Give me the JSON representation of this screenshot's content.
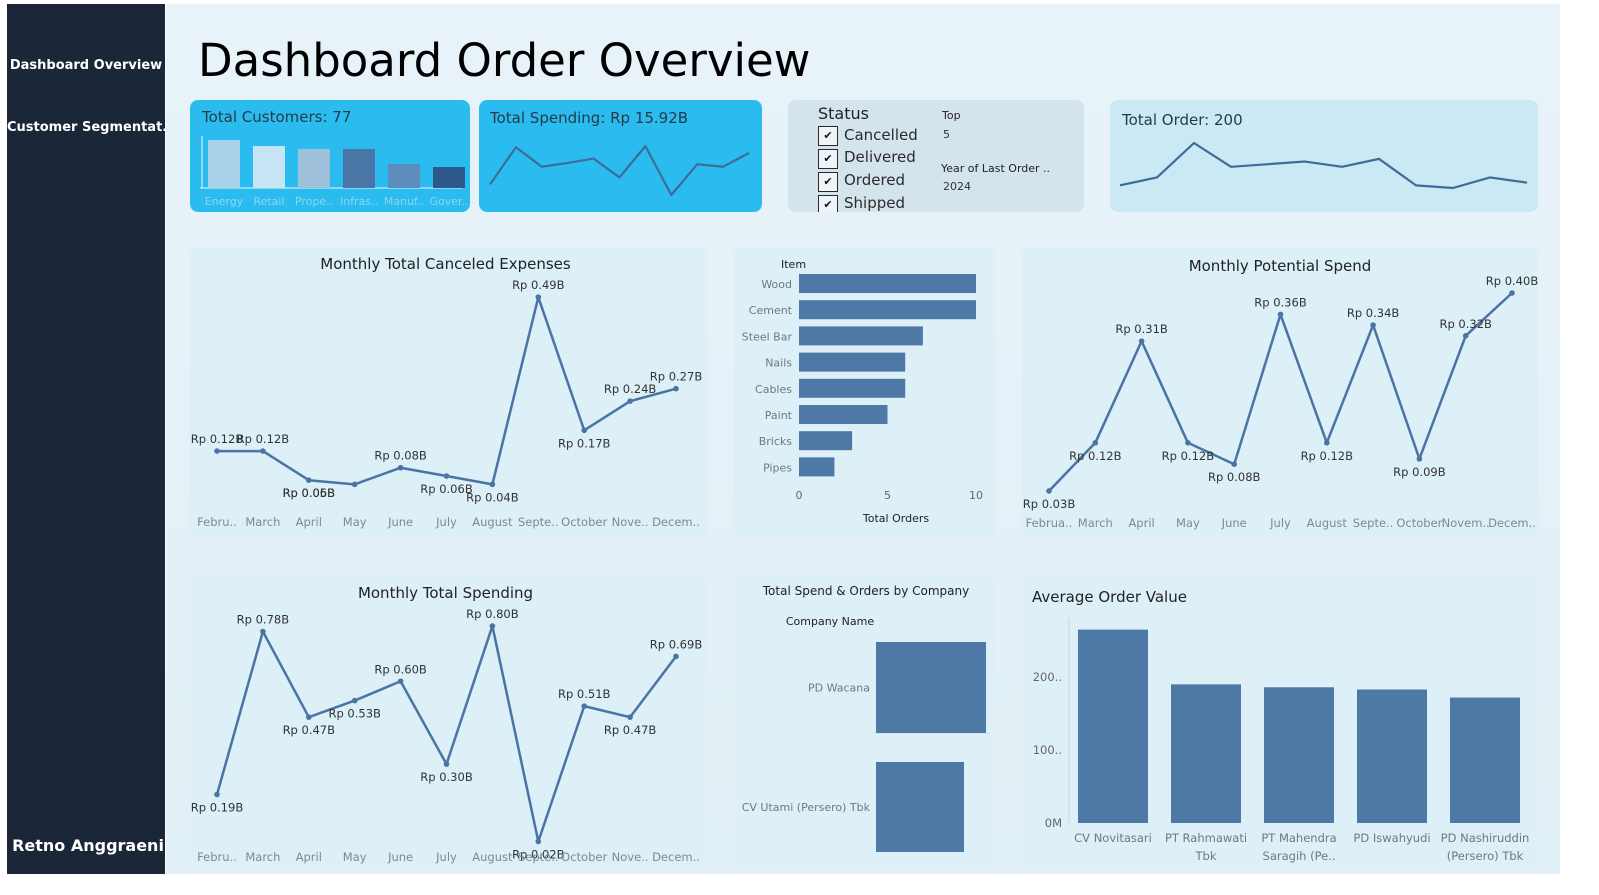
{
  "sidebar": {
    "items": [
      {
        "label": "Dashboard Overview"
      },
      {
        "label": "Customer Segmentat.."
      }
    ],
    "author": "Retno Anggraeni"
  },
  "page_title": "Dashboard Order Overview",
  "kpis": {
    "customers": {
      "title": "Total Customers: 77"
    },
    "spending": {
      "title": "Total Spending: Rp 15.92B"
    },
    "orders": {
      "title": "Total Order: 200"
    }
  },
  "filters": {
    "status_title": "Status",
    "status_options": [
      {
        "label": "Cancelled",
        "check": "✔"
      },
      {
        "label": "Delivered",
        "check": "✔"
      },
      {
        "label": "Ordered",
        "check": "✔"
      },
      {
        "label": "Shipped",
        "check": "✔"
      }
    ],
    "top_label": "Top",
    "top_value": "5",
    "year_label": "Year of Last Order ..",
    "year_value": "2024"
  },
  "colors": {
    "line": "#4a74a4",
    "bar": "#4e79a7",
    "kpi_blue": "#2bbcef",
    "sidebar": "#1b2738"
  },
  "chart_data": [
    {
      "id": "customers_mini",
      "type": "bar",
      "categories": [
        "Energy",
        "Retail",
        "Prope..",
        "Infras..",
        "Manuf..",
        "Gover.."
      ],
      "values": [
        16,
        14,
        13,
        13,
        8,
        7
      ],
      "colors": [
        "#a9d3ea",
        "#c6e4f3",
        "#9ec0da",
        "#4a76a6",
        "#5d8dbd",
        "#2d5a8a"
      ]
    },
    {
      "id": "spending_mini",
      "type": "line",
      "values": [
        0.19,
        0.78,
        0.47,
        0.53,
        0.6,
        0.3,
        0.8,
        0.02,
        0.51,
        0.47,
        0.69
      ]
    },
    {
      "id": "orders_mini",
      "type": "line",
      "values": [
        12,
        15,
        28,
        19,
        20,
        21,
        19,
        22,
        12,
        11,
        15,
        13
      ]
    },
    {
      "id": "canceled",
      "type": "line",
      "title": "Monthly Total Canceled Expenses",
      "categories": [
        "Febru..",
        "March",
        "April",
        "May",
        "June",
        "July",
        "August",
        "Septe..",
        "October",
        "Nove..",
        "Decem.."
      ],
      "values": [
        0.12,
        0.12,
        0.05,
        0.04,
        0.08,
        0.06,
        0.04,
        0.49,
        0.17,
        0.24,
        0.27
      ],
      "labels": [
        "Rp 0.12B",
        "Rp 0.12B",
        "Rp 0.05B",
        "",
        "Rp 0.08B",
        "",
        "Rp 0.04B",
        "Rp 0.49B",
        "Rp 0.17B",
        "Rp 0.24B",
        "Rp 0.27B"
      ],
      "extra_labels": [
        {
          "i": 2,
          "text": "Rp 0.06B"
        },
        {
          "i": 5,
          "text": "Rp 0.06B"
        }
      ],
      "ylim": [
        0,
        0.5
      ]
    },
    {
      "id": "items",
      "type": "bar",
      "orientation": "horizontal",
      "header": "Item",
      "categories": [
        "Wood",
        "Cement",
        "Steel Bar",
        "Nails",
        "Cables",
        "Paint",
        "Bricks",
        "Pipes"
      ],
      "values": [
        10,
        10,
        7,
        6,
        6,
        5,
        3,
        2
      ],
      "xticks": [
        0,
        5,
        10
      ],
      "xlabel": "Total Orders",
      "xlim": [
        0,
        10
      ]
    },
    {
      "id": "potential",
      "type": "line",
      "title": "Monthly Potential Spend",
      "categories": [
        "Februa..",
        "March",
        "April",
        "May",
        "June",
        "July",
        "August",
        "Septe..",
        "October",
        "Novem..",
        "Decem.."
      ],
      "values": [
        0.03,
        0.12,
        0.31,
        0.12,
        0.08,
        0.36,
        0.12,
        0.34,
        0.09,
        0.32,
        0.4
      ],
      "labels": [
        "Rp 0.03B",
        "Rp 0.12B",
        "Rp 0.31B",
        "Rp 0.12B",
        "Rp 0.08B",
        "Rp 0.36B",
        "Rp 0.12B",
        "Rp 0.34B",
        "Rp 0.09B",
        "Rp 0.32B",
        "Rp 0.40B"
      ],
      "ylim": [
        0,
        0.4
      ]
    },
    {
      "id": "spending",
      "type": "line",
      "title": "Monthly Total Spending",
      "categories": [
        "Febru..",
        "March",
        "April",
        "May",
        "June",
        "July",
        "August",
        "Septe..",
        "October",
        "Nove..",
        "Decem.."
      ],
      "values": [
        0.19,
        0.78,
        0.47,
        0.53,
        0.6,
        0.3,
        0.8,
        0.02,
        0.51,
        0.47,
        0.69
      ],
      "labels": [
        "Rp 0.19B",
        "Rp 0.78B",
        "Rp 0.47B",
        "Rp 0.53B",
        "Rp 0.60B",
        "Rp 0.30B",
        "Rp 0.80B",
        "Rp 0.02B",
        "Rp 0.51B",
        "Rp 0.47B",
        "Rp 0.69B"
      ],
      "ylim": [
        0,
        0.8
      ]
    },
    {
      "id": "company",
      "type": "bar",
      "orientation": "horizontal",
      "title": "Total Spend & Orders by Company",
      "header": "Company Name",
      "categories": [
        "PD Wacana",
        "CV Utami (Persero) Tbk"
      ],
      "values": [
        100,
        80
      ]
    },
    {
      "id": "aov",
      "type": "bar",
      "title": "Average Order Value",
      "categories": [
        [
          "CV Novitasari"
        ],
        [
          "PT Rahmawati",
          "Tbk"
        ],
        [
          "PT Mahendra",
          "Saragih (Pe.."
        ],
        [
          "PD Iswahyudi"
        ],
        [
          "PD Nashiruddin",
          "(Persero) Tbk"
        ]
      ],
      "values": [
        265,
        190,
        186,
        183,
        172
      ],
      "yticks": [
        {
          "v": 0,
          "label": "0M"
        },
        {
          "v": 100,
          "label": "100.."
        },
        {
          "v": 200,
          "label": "200.."
        }
      ],
      "ylim": [
        0,
        270
      ]
    }
  ]
}
